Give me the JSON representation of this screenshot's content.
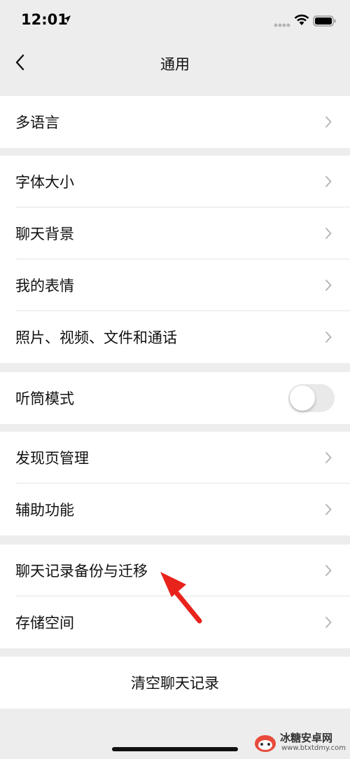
{
  "status_bar": {
    "time": "12:01"
  },
  "nav": {
    "title": "通用"
  },
  "groups": [
    {
      "items": [
        {
          "label": "多语言"
        }
      ]
    },
    {
      "items": [
        {
          "label": "字体大小"
        },
        {
          "label": "聊天背景"
        },
        {
          "label": "我的表情"
        },
        {
          "label": "照片、视频、文件和通话"
        }
      ]
    },
    {
      "items": [
        {
          "label": "听筒模式",
          "toggle": false
        }
      ]
    },
    {
      "items": [
        {
          "label": "发现页管理"
        },
        {
          "label": "辅助功能"
        }
      ]
    },
    {
      "items": [
        {
          "label": "聊天记录备份与迁移"
        },
        {
          "label": "存储空间"
        }
      ]
    }
  ],
  "clear_button": {
    "label": "清空聊天记录"
  },
  "watermark": {
    "name": "冰糖安卓网",
    "url": "www.btxtdmy.com"
  },
  "colors": {
    "background": "#ededed",
    "card": "#ffffff",
    "annotation_arrow": "#e8231c"
  }
}
